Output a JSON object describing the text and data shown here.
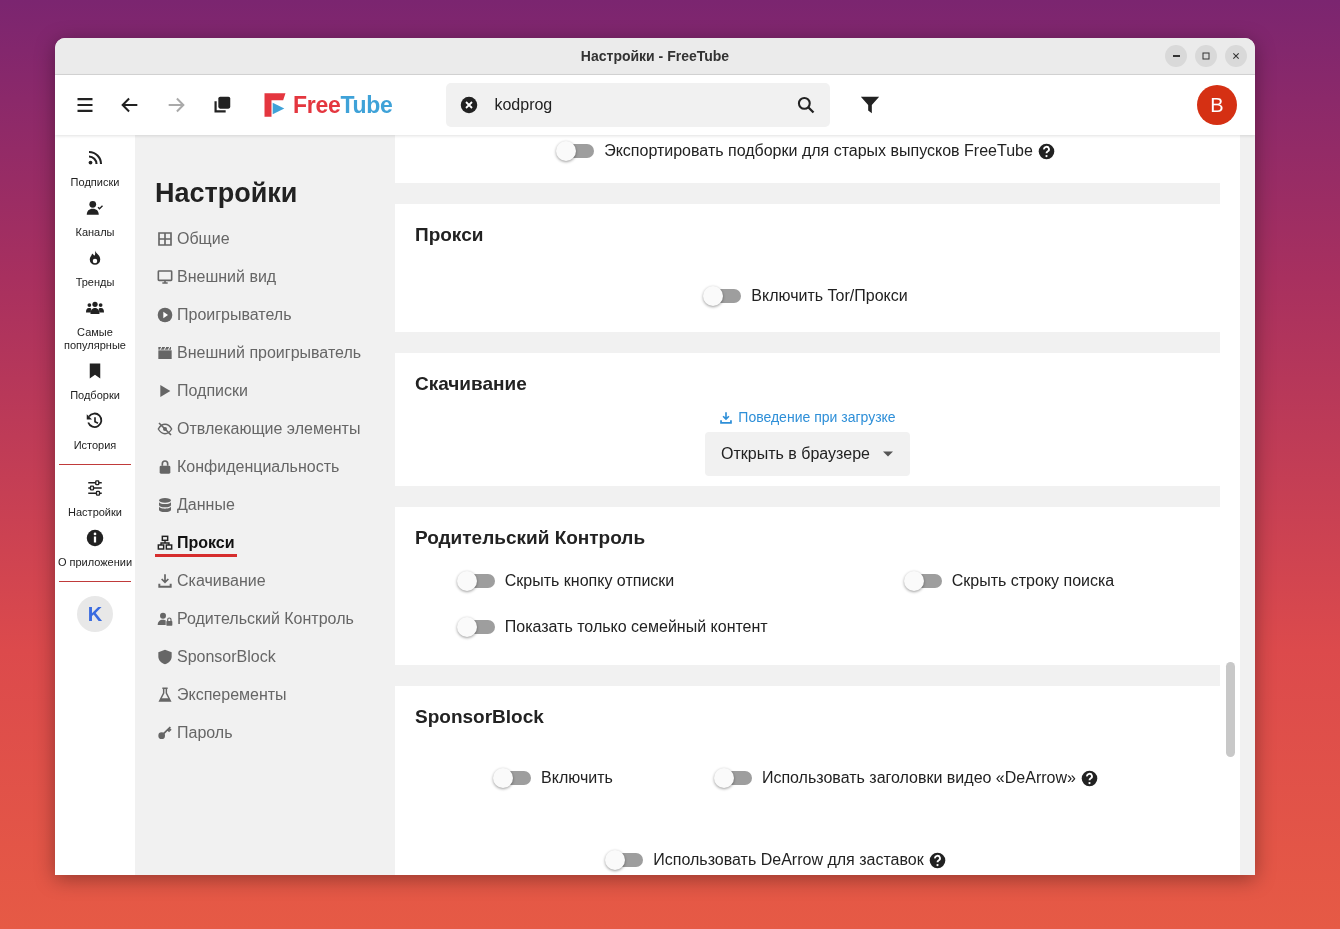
{
  "window": {
    "title": "Настройки - FreeTube"
  },
  "header": {
    "nav_buttons": [
      {
        "disabled": false
      },
      {
        "disabled": true
      }
    ],
    "logo_text": [
      "Free",
      "Tube"
    ],
    "search": {
      "value": "kodprog"
    },
    "avatar_letter": "B"
  },
  "nav_rail": {
    "items": [
      {
        "label": "Подписки"
      },
      {
        "label": "Каналы"
      },
      {
        "label": "Тренды"
      },
      {
        "label": "Самые популярные"
      },
      {
        "label": "Подборки"
      },
      {
        "label": "История"
      },
      {
        "label": "Настройки"
      },
      {
        "label": "О приложении"
      }
    ],
    "profile_letter": "K"
  },
  "settings_menu": {
    "title": "Настройки",
    "items": [
      {
        "label": "Общие",
        "selected": false
      },
      {
        "label": "Внешний вид",
        "selected": false
      },
      {
        "label": "Проигрыватель",
        "selected": false
      },
      {
        "label": "Внешний проигрыватель",
        "selected": false
      },
      {
        "label": "Подписки",
        "selected": false
      },
      {
        "label": "Отвлекающие элементы",
        "selected": false
      },
      {
        "label": "Конфиденциальность",
        "selected": false
      },
      {
        "label": "Данные",
        "selected": false
      },
      {
        "label": "Прокси",
        "selected": true
      },
      {
        "label": "Скачивание",
        "selected": false
      },
      {
        "label": "Родительский Контроль",
        "selected": false
      },
      {
        "label": "SponsorBlock",
        "selected": false
      },
      {
        "label": "Эксперементы",
        "selected": false
      },
      {
        "label": "Пароль",
        "selected": false
      }
    ]
  },
  "sections": [
    {
      "items": [
        {
          "kind": "toggle",
          "label": "Экспортировать подборки для старых выпусков FreeTube",
          "on": false,
          "help": true
        }
      ]
    },
    {
      "title": "Прокси",
      "items": [
        {
          "kind": "toggle",
          "label": "Включить Tor/Прокси",
          "on": false,
          "help": false
        }
      ]
    },
    {
      "title": "Скачивание",
      "items": [
        {
          "kind": "select",
          "label": "Поведение при загрузке",
          "value": "Открыть в браузере"
        }
      ]
    },
    {
      "title": "Родительский Контроль",
      "items": [
        {
          "kind": "toggle",
          "label": "Скрыть кнопку отписки",
          "on": false,
          "help": false
        },
        {
          "kind": "toggle",
          "label": "Скрыть строку поиска",
          "on": false,
          "help": false
        },
        {
          "kind": "toggle",
          "label": "Показать только семейный контент",
          "on": false,
          "help": false
        }
      ]
    },
    {
      "title": "SponsorBlock",
      "items": [
        {
          "kind": "toggle",
          "label": "Включить",
          "on": false,
          "help": false
        },
        {
          "kind": "toggle",
          "label": "Использовать заголовки видео «DeArrow»",
          "on": false,
          "help": true
        },
        {
          "kind": "toggle",
          "label": "Использовать DeArrow для заставок",
          "on": false,
          "help": true
        }
      ]
    }
  ]
}
